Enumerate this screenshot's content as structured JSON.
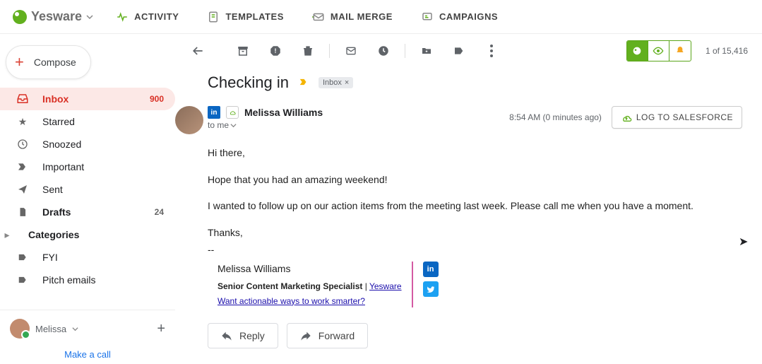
{
  "brand": {
    "name": "Yesware"
  },
  "topnav": {
    "activity": "ACTIVITY",
    "templates": "TEMPLATES",
    "mailmerge": "MAIL MERGE",
    "campaigns": "CAMPAIGNS"
  },
  "compose": {
    "label": "Compose"
  },
  "sidebar": {
    "items": [
      {
        "label": "Inbox",
        "count": "900"
      },
      {
        "label": "Starred"
      },
      {
        "label": "Snoozed"
      },
      {
        "label": "Important"
      },
      {
        "label": "Sent"
      },
      {
        "label": "Drafts",
        "count": "24"
      },
      {
        "label": "Categories"
      },
      {
        "label": "FYI"
      },
      {
        "label": "Pitch emails"
      }
    ]
  },
  "profile": {
    "name": "Melissa"
  },
  "makecall": {
    "label": "Make a call"
  },
  "toolbar": {
    "pager": "1 of 15,416"
  },
  "thread": {
    "subject": "Checking in",
    "label": "Inbox",
    "sender": "Melissa Williams",
    "to": "to me",
    "timestamp": "8:54 AM (0 minutes ago)",
    "sf_button": "LOG TO SALESFORCE"
  },
  "body": {
    "p1": "Hi there,",
    "p2": "Hope that you had an amazing weekend!",
    "p3": "I wanted to follow up on our action items from the meeting last week. Please call me when you have a moment.",
    "p4": "Thanks,",
    "sig_divider": "--"
  },
  "signature": {
    "name": "Melissa Williams",
    "title": "Senior Content Marketing Specialist",
    "sep": " | ",
    "company": "Yesware",
    "cta": "Want actionable ways to work smarter?"
  },
  "actions": {
    "reply": "Reply",
    "forward": "Forward"
  }
}
